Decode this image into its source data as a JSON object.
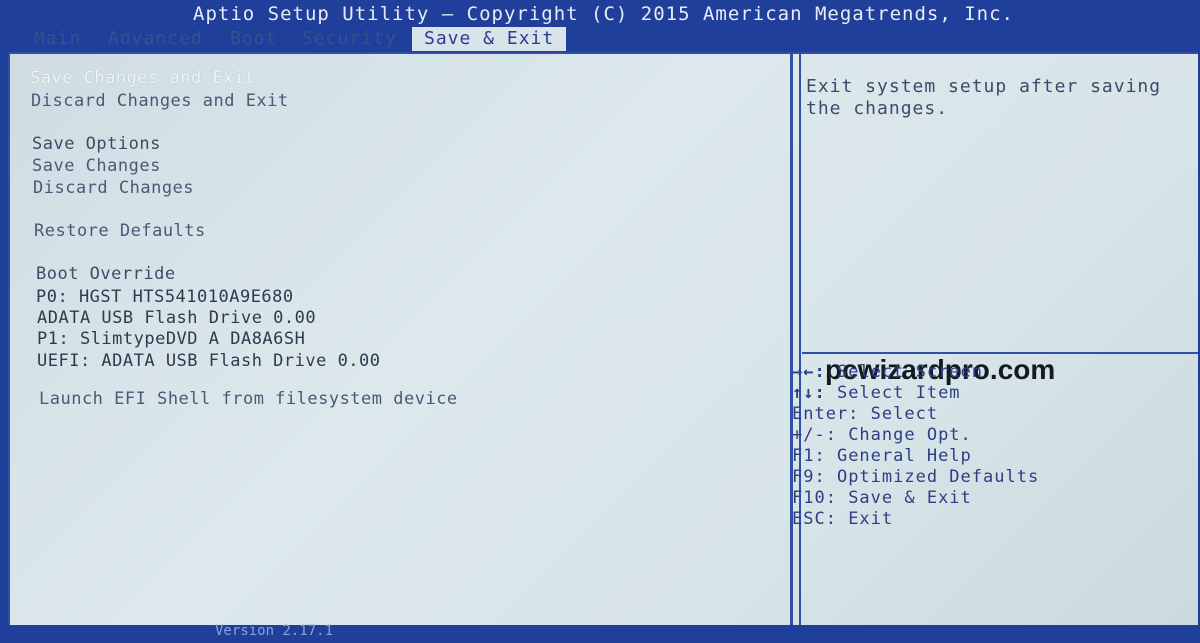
{
  "title": "Aptio Setup Utility – Copyright (C) 2015 American Megatrends, Inc.",
  "tabs": [
    {
      "label": "Main"
    },
    {
      "label": "Advanced"
    },
    {
      "label": "Boot"
    },
    {
      "label": "Security"
    },
    {
      "label": "Save & Exit"
    }
  ],
  "menu": {
    "save_changes_and_exit": "Save Changes and Exit",
    "discard_changes_and_exit": "Discard Changes and Exit",
    "save_options_header": "Save Options",
    "save_changes": "Save Changes",
    "discard_changes": "Discard Changes",
    "restore_defaults": "Restore Defaults",
    "boot_override_header": "Boot Override",
    "devices": [
      "P0: HGST HTS541010A9E680",
      "ADATA USB Flash Drive 0.00",
      "P1: SlimtypeDVD A  DA8A6SH",
      "UEFI: ADATA USB Flash Drive 0.00"
    ],
    "launch_efi_shell": "Launch EFI Shell from filesystem device"
  },
  "help_text": "Exit system setup after saving the changes.",
  "watermark": "pcwizardpro.com",
  "key_help": [
    {
      "keys": "→←:",
      "text": " Select Screen"
    },
    {
      "keys": "↑↓:",
      "text": " Select Item"
    },
    {
      "keys": "Enter:",
      "text": " Select"
    },
    {
      "keys": "+/-:",
      "text": " Change Opt."
    },
    {
      "keys": "F1:",
      "text": " General Help"
    },
    {
      "keys": "F9:",
      "text": " Optimized Defaults"
    },
    {
      "keys": "F10:",
      "text": " Save & Exit"
    },
    {
      "keys": "ESC:",
      "text": " Exit"
    }
  ],
  "version": "Version 2.17.1"
}
